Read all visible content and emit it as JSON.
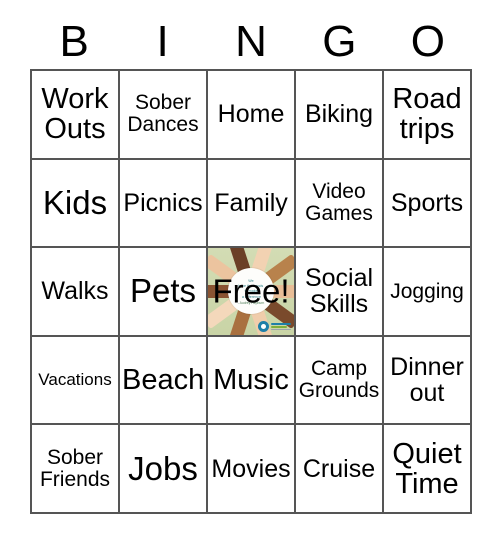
{
  "header": {
    "letters": [
      "B",
      "I",
      "N",
      "G",
      "O"
    ]
  },
  "grid": {
    "rows": [
      [
        {
          "label": "Work Outs",
          "size": "lg"
        },
        {
          "label": "Sober Dances",
          "size": "sm"
        },
        {
          "label": "Home",
          "size": "md"
        },
        {
          "label": "Biking",
          "size": "md"
        },
        {
          "label": "Road trips",
          "size": "lg"
        }
      ],
      [
        {
          "label": "Kids",
          "size": "xl"
        },
        {
          "label": "Picnics",
          "size": "md"
        },
        {
          "label": "Family",
          "size": "md"
        },
        {
          "label": "Video Games",
          "size": "sm"
        },
        {
          "label": "Sports",
          "size": "md"
        }
      ],
      [
        {
          "label": "Walks",
          "size": "md"
        },
        {
          "label": "Pets",
          "size": "xl"
        },
        {
          "label": "Free!",
          "size": "lg",
          "free": true
        },
        {
          "label": "Social Skills",
          "size": "md"
        },
        {
          "label": "Jogging",
          "size": "sm"
        }
      ],
      [
        {
          "label": "Vacations",
          "size": "xs"
        },
        {
          "label": "Beach",
          "size": "lg"
        },
        {
          "label": "Music",
          "size": "lg"
        },
        {
          "label": "Camp Grounds",
          "size": "sm"
        },
        {
          "label": "Dinner out",
          "size": "md"
        }
      ],
      [
        {
          "label": "Sober Friends",
          "size": "sm"
        },
        {
          "label": "Jobs",
          "size": "xl"
        },
        {
          "label": "Movies",
          "size": "md"
        },
        {
          "label": "Cruise",
          "size": "md"
        },
        {
          "label": "Quiet Time",
          "size": "lg"
        }
      ]
    ]
  },
  "free_space": {
    "label": "Free!",
    "art": {
      "caption_lines": [
        "We",
        "have the hands",
        "to make",
        "a difference"
      ],
      "attribution": "- Audrey Hepburn",
      "background_color": "#cfd9b0",
      "caption_color": "#2f7f86",
      "logo_color": "#1d7fa8"
    }
  },
  "colors": {
    "grid_line": "#555555",
    "cell_background": "#ffffff",
    "text": "#000000",
    "page_background": "#ffffff"
  }
}
